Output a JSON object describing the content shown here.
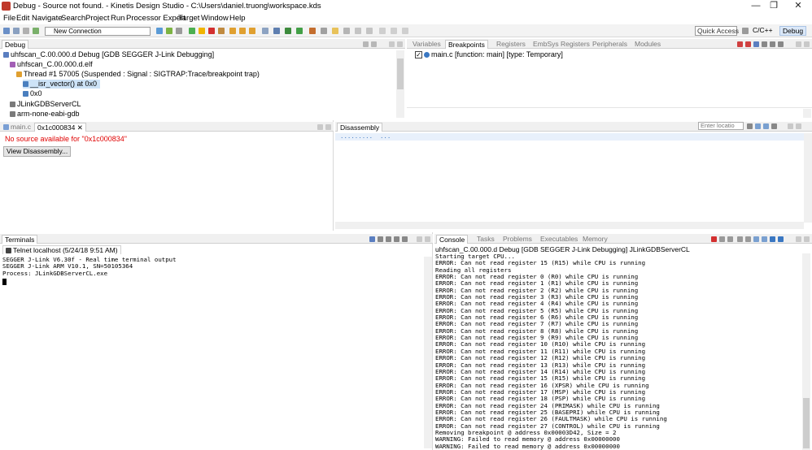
{
  "window": {
    "title": "Debug - Source not found. - Kinetis Design Studio - C:\\Users\\daniel.truong\\workspace.kds",
    "minimize": "—",
    "maximize": "❐",
    "close": "✕"
  },
  "menu": [
    "File",
    "Edit",
    "Navigate",
    "Search",
    "Project",
    "Run",
    "Processor Expert",
    "Target",
    "Window",
    "Help"
  ],
  "toolbar": {
    "connection": "New Connection",
    "quick_access": "Quick Access",
    "perspectives": [
      "C/C++",
      "Debug"
    ]
  },
  "debug_view": {
    "tab": "Debug",
    "tree": [
      "uhfscan_C.00.000.d Debug [GDB SEGGER J-Link Debugging]",
      "uhfscan_C.00.000.d.elf",
      "Thread #1 57005 (Suspended : Signal : SIGTRAP:Trace/breakpoint trap)",
      "__isr_vector() at 0x0",
      "0x0",
      "JLinkGDBServerCL",
      "arm-none-eabi-gdb"
    ]
  },
  "breakpoints_view": {
    "tabs": [
      "Variables",
      "Breakpoints",
      "Registers",
      "EmbSys Registers",
      "Peripherals",
      "Modules"
    ],
    "items": [
      "main.c [function: main] [type: Temporary]"
    ]
  },
  "editor": {
    "tabs": [
      "main.c",
      "0x1c000834"
    ],
    "message": "No source available for \"0x1c000834\"",
    "button": "View Disassembly..."
  },
  "disassembly": {
    "tab": "Disassembly",
    "location_placeholder": "Enter locatio",
    "line": ".........  ..."
  },
  "terminals": {
    "tab": "Terminals",
    "subtab": "Telnet localhost (5/24/18 9:51 AM)",
    "lines": [
      "SEGGER J-Link V6.30f - Real time terminal output",
      "SEGGER J-Link ARM V10.1, SN=50105364",
      "Process: JLinkGDBServerCL.exe"
    ]
  },
  "console": {
    "tabs": [
      "Console",
      "Tasks",
      "Problems",
      "Executables",
      "Memory"
    ],
    "header": "uhfscan_C.00.000.d Debug [GDB SEGGER J-Link Debugging] JLinkGDBServerCL",
    "lines": [
      "Starting target CPU...",
      "ERROR: Can not read register 15 (R15) while CPU is running",
      "Reading all registers",
      "ERROR: Can not read register 0 (R0) while CPU is running",
      "ERROR: Can not read register 1 (R1) while CPU is running",
      "ERROR: Can not read register 2 (R2) while CPU is running",
      "ERROR: Can not read register 3 (R3) while CPU is running",
      "ERROR: Can not read register 4 (R4) while CPU is running",
      "ERROR: Can not read register 5 (R5) while CPU is running",
      "ERROR: Can not read register 6 (R6) while CPU is running",
      "ERROR: Can not read register 7 (R7) while CPU is running",
      "ERROR: Can not read register 8 (R8) while CPU is running",
      "ERROR: Can not read register 9 (R9) while CPU is running",
      "ERROR: Can not read register 10 (R10) while CPU is running",
      "ERROR: Can not read register 11 (R11) while CPU is running",
      "ERROR: Can not read register 12 (R12) while CPU is running",
      "ERROR: Can not read register 13 (R13) while CPU is running",
      "ERROR: Can not read register 14 (R14) while CPU is running",
      "ERROR: Can not read register 15 (R15) while CPU is running",
      "ERROR: Can not read register 16 (XPSR) while CPU is running",
      "ERROR: Can not read register 17 (MSP) while CPU is running",
      "ERROR: Can not read register 18 (PSP) while CPU is running",
      "ERROR: Can not read register 24 (PRIMASK) while CPU is running",
      "ERROR: Can not read register 25 (BASEPRI) while CPU is running",
      "ERROR: Can not read register 26 (FAULTMASK) while CPU is running",
      "ERROR: Can not read register 27 (CONTROL) while CPU is running",
      "Removing breakpoint @ address 0x00003D42, Size = 2",
      "WARNING: Failed to read memory @ address 0x00000000",
      "WARNING: Failed to read memory @ address 0x00000000"
    ]
  },
  "colors": {
    "error_text": "#e00000",
    "selection": "#cde3f7",
    "accent": "#3a77c2"
  }
}
